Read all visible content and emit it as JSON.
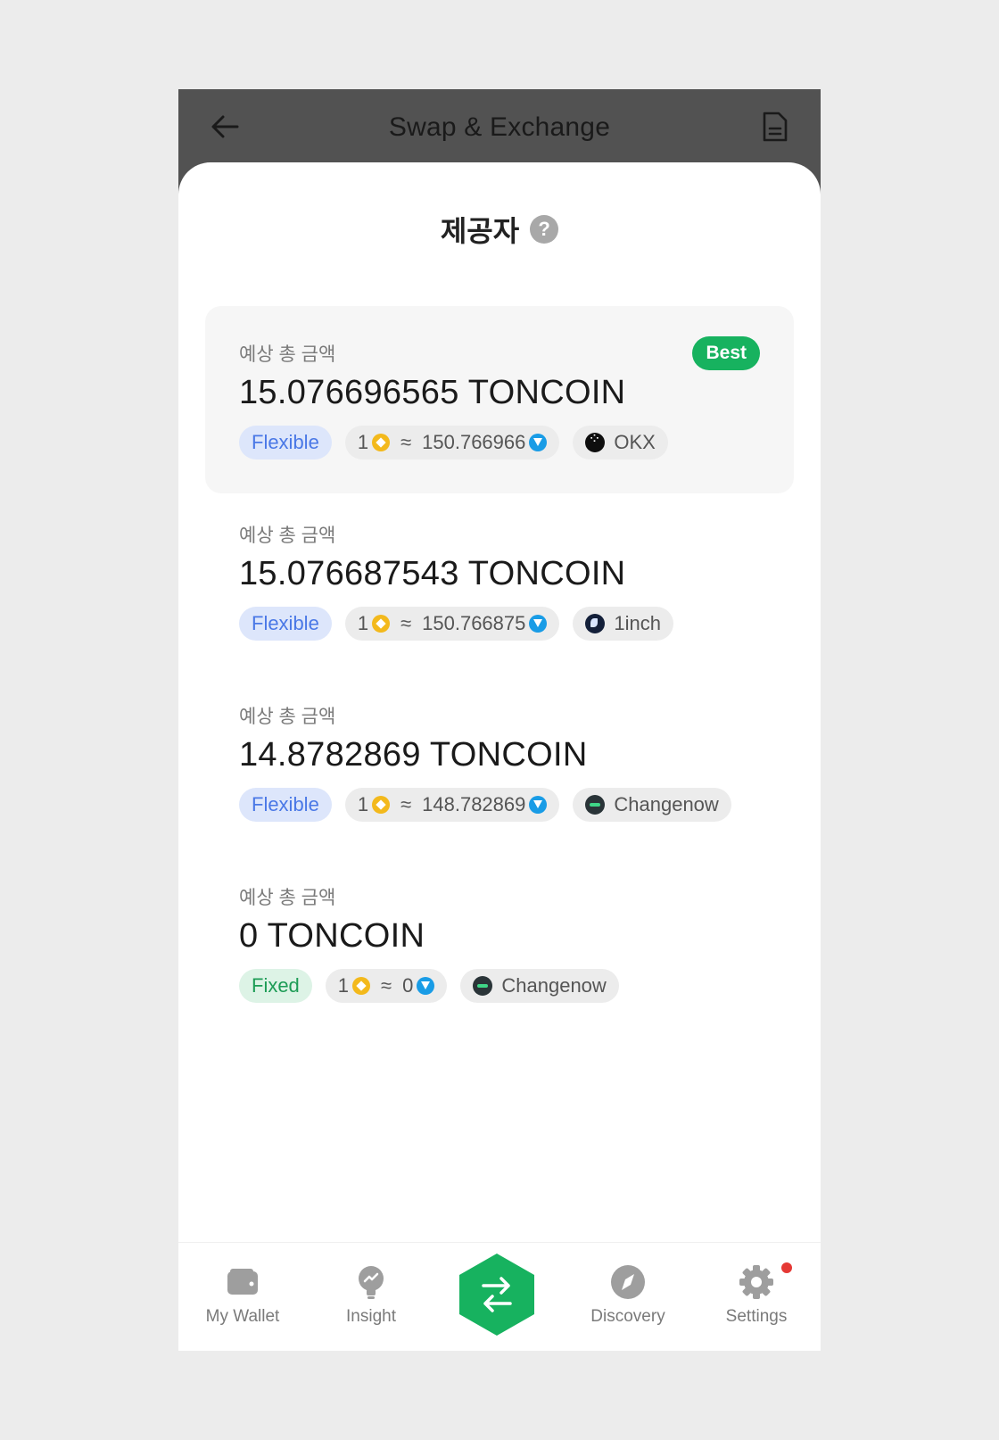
{
  "header": {
    "title": "Swap & Exchange"
  },
  "sheet": {
    "title": "제공자"
  },
  "offers": [
    {
      "label": "예상 총 금액",
      "amount": "15.076696565 TONCOIN",
      "best": "Best",
      "mode": "Flexible",
      "rate_from": "1",
      "rate_sep": "≈",
      "rate_to": "150.766966",
      "provider": "OKX"
    },
    {
      "label": "예상 총 금액",
      "amount": "15.076687543 TONCOIN",
      "mode": "Flexible",
      "rate_from": "1",
      "rate_sep": "≈",
      "rate_to": "150.766875",
      "provider": "1inch"
    },
    {
      "label": "예상 총 금액",
      "amount": "14.8782869 TONCOIN",
      "mode": "Flexible",
      "rate_from": "1",
      "rate_sep": "≈",
      "rate_to": "148.782869",
      "provider": "Changenow"
    },
    {
      "label": "예상 총 금액",
      "amount": "0 TONCOIN",
      "mode": "Fixed",
      "rate_from": "1",
      "rate_sep": "≈",
      "rate_to": "0",
      "provider": "Changenow"
    }
  ],
  "nav": {
    "wallet": "My Wallet",
    "insight": "Insight",
    "discovery": "Discovery",
    "settings": "Settings"
  },
  "icons": {
    "back": "arrow-left-icon",
    "history": "document-icon",
    "help": "question-icon",
    "swap": "swap-arrows-icon"
  },
  "colors": {
    "accent": "#17b25f",
    "header_bg": "#525252",
    "flexible": "#4a78e6",
    "fixed": "#1d9c56",
    "notification": "#e53935"
  }
}
